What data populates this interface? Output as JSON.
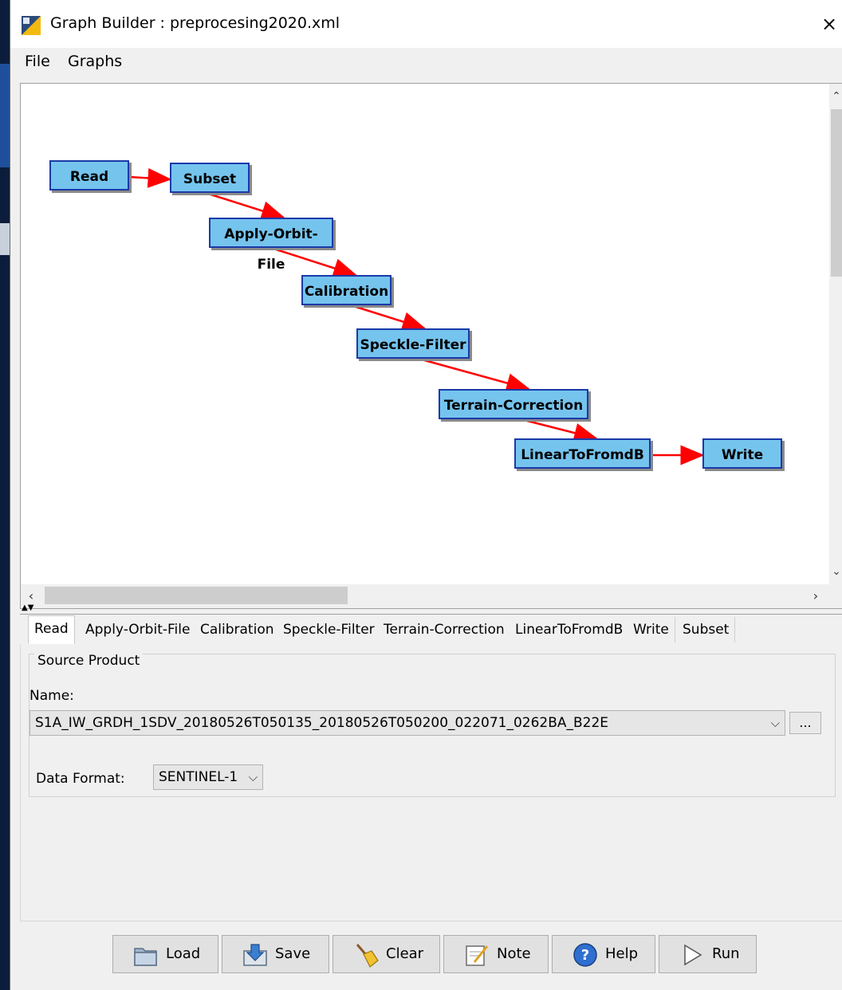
{
  "window": {
    "title": "Graph Builder : preprocesing2020.xml",
    "close_symbol": "×"
  },
  "menu": {
    "items": [
      "File",
      "Graphs"
    ]
  },
  "graph": {
    "nodes": [
      {
        "id": "read",
        "label": "Read"
      },
      {
        "id": "subset",
        "label": "Subset"
      },
      {
        "id": "orbit",
        "label": "Apply-Orbit-File"
      },
      {
        "id": "calib",
        "label": "Calibration"
      },
      {
        "id": "speckle",
        "label": "Speckle-Filter"
      },
      {
        "id": "terrain",
        "label": "Terrain-Correction"
      },
      {
        "id": "lindb",
        "label": "LinearToFromdB"
      },
      {
        "id": "write",
        "label": "Write"
      }
    ],
    "edges": [
      [
        "read",
        "subset"
      ],
      [
        "subset",
        "orbit"
      ],
      [
        "orbit",
        "calib"
      ],
      [
        "calib",
        "speckle"
      ],
      [
        "speckle",
        "terrain"
      ],
      [
        "terrain",
        "lindb"
      ],
      [
        "lindb",
        "write"
      ]
    ],
    "node_color": "#75c4ee",
    "edge_color": "#ff0000"
  },
  "tabs": {
    "items": [
      "Read",
      "Apply-Orbit-File",
      "Calibration",
      "Speckle-Filter",
      "Terrain-Correction",
      "LinearToFromdB",
      "Write",
      "Subset"
    ],
    "active": "Read"
  },
  "read_panel": {
    "group_title": "Source Product",
    "name_label": "Name:",
    "name_value": "S1A_IW_GRDH_1SDV_20180526T050135_20180526T050200_022071_0262BA_B22E",
    "browse_label": "...",
    "format_label": "Data Format:",
    "format_value": "SENTINEL-1"
  },
  "buttons": {
    "load": "Load",
    "save": "Save",
    "clear": "Clear",
    "note": "Note",
    "help": "Help",
    "run": "Run"
  }
}
